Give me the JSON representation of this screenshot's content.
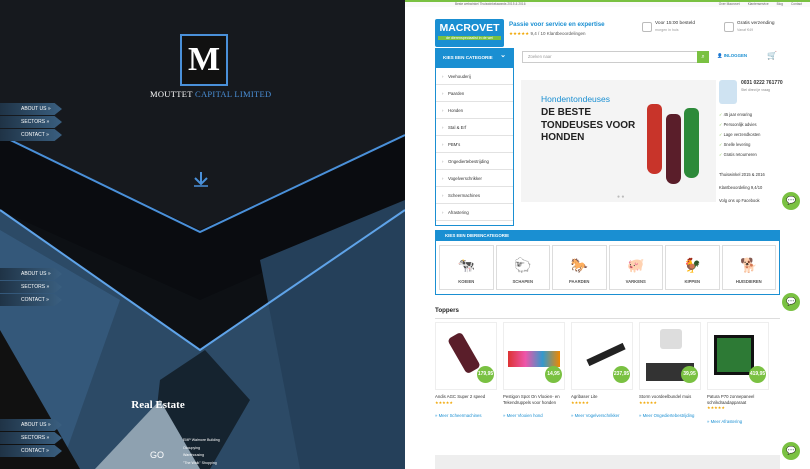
{
  "left": {
    "logo_letter": "M",
    "logo_name_part1": "MOUTTET",
    "logo_name_part2": "CAPITAL LIMITED",
    "nav_groups": [
      [
        "ABOUT US »",
        "SECTORS »",
        "CONTACT »"
      ],
      [
        "ABOUT US »",
        "SECTORS »",
        "CONTACT »"
      ],
      [
        "ABOUT US »",
        "SECTORS »",
        "CONTACT »"
      ]
    ],
    "section_title": "Real Estate",
    "go_label": "GO",
    "re_items": [
      "EMP Walmore Building",
      "Occupying",
      "Warehousing",
      "\"The Walk\" Shopping"
    ],
    "accent": "#4a90d9"
  },
  "right": {
    "topbar_text": "Beste webwinkel Thuiswinkelawards 2015 & 2016",
    "topbar_links": [
      "Over Macrovet",
      "Klantenservice",
      "Blog",
      "Contact"
    ],
    "brand": "MACROVET",
    "brand_sub": "de dierenspeciaalist in de wei",
    "tagline": "Passie voor service en expertise",
    "rating": "★★★★★",
    "rating_text": "9,4 / 10  Klantbeoordelingen",
    "usp1_title": "Voor 15:00 besteld",
    "usp1_sub": "morgen in huis",
    "usp2_title": "Gratis verzending",
    "usp2_sub": "Vanaf €49",
    "category_button": "KIES EEN CATEGORIE",
    "search_placeholder": "Zoeken naar",
    "search_icon_glyph": "⌕",
    "login_label": "INLOGGEN",
    "cart_glyph": "🛒",
    "categories": [
      "Veehouderij",
      "Paarden",
      "Honden",
      "Stal & Erf",
      "PBM's",
      "Ongediertebestrijding",
      "Vogelverschrikker",
      "Scheermachines",
      "Afrastering"
    ],
    "hero_sub": "Hondentondeuses",
    "hero_title": "DE BESTE TONDEUSES VOOR HONDEN",
    "phone": "0031 0222 761770",
    "phone_sub": "Stel direct je vraag",
    "benefits": [
      "45 jaar ervaring",
      "Persoonlijk advies",
      "Lage verzendkosten",
      "Snelle levering",
      "Gratis retourneren"
    ],
    "social": [
      "Thuiswinkel 2015 & 2016",
      "Klantbeoordeling 9,4/10",
      "Volg ons op Facebook"
    ],
    "animal_head": "KIES EEN DIERENCATEGORIE",
    "animals": [
      {
        "label": "KOEIEN",
        "glyph": "🐄"
      },
      {
        "label": "SCHAPEN",
        "glyph": "🐑"
      },
      {
        "label": "PAARDEN",
        "glyph": "🐎"
      },
      {
        "label": "VARKENS",
        "glyph": "🐖"
      },
      {
        "label": "KIPPEN",
        "glyph": "🐓"
      },
      {
        "label": "HUISDIEREN",
        "glyph": "🐕"
      }
    ],
    "toppers_title": "Toppers",
    "products": [
      {
        "name": "Andis AGC Super 2 speed",
        "price": "179,95",
        "more": "» Meer Scheermachines"
      },
      {
        "name": "Pestigon Spot On Vlooien- en Tekendruppels voor honden",
        "price": "14,95",
        "more": "» Meer Vlooien hond"
      },
      {
        "name": "Agribaser Lite",
        "price": "237,95",
        "more": "» Meer Vogelverschrikker"
      },
      {
        "name": "Storm voordeelbundel muis",
        "price": "39,95",
        "more": "» Meer Ongediertebestrijding"
      },
      {
        "name": "Patura P70 zonnepaneel schrikdraadapparaat",
        "price": "419,95",
        "more": "» Meer Afrastering"
      }
    ],
    "chat_glyph": "💬",
    "brand_blue": "#1a8fd2",
    "brand_green": "#7ac142"
  }
}
